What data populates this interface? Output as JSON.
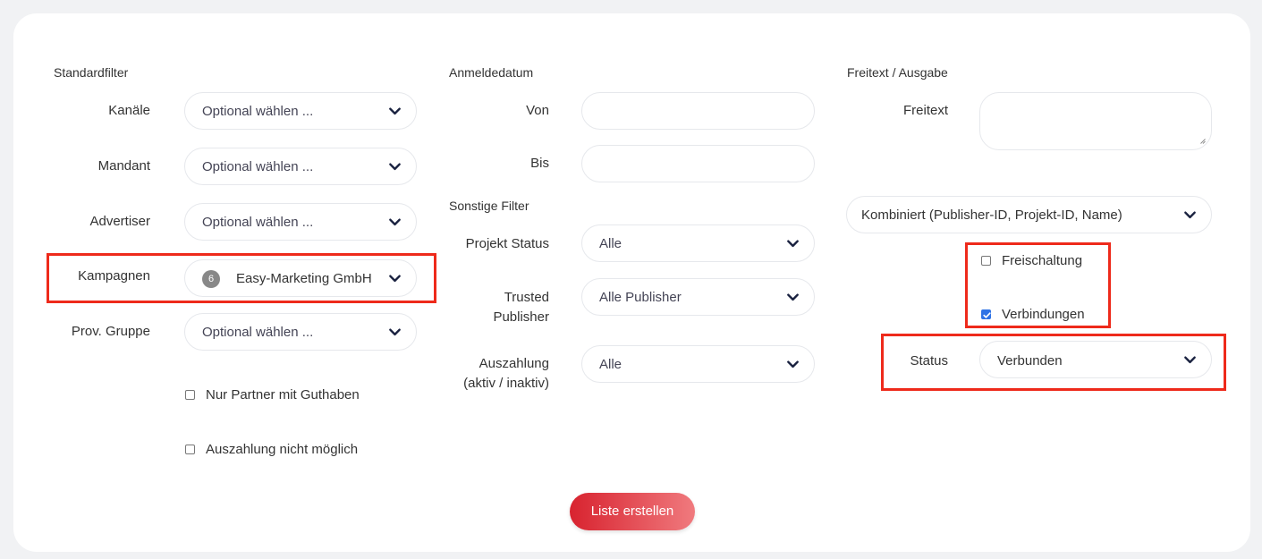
{
  "col1": {
    "section_title": "Standardfilter",
    "fields": [
      {
        "label": "Kanäle",
        "value": "Optional wählen ..."
      },
      {
        "label": "Mandant",
        "value": "Optional wählen ..."
      },
      {
        "label": "Advertiser",
        "value": "Optional wählen ..."
      },
      {
        "label": "Kampagnen",
        "value": "Easy-Marketing GmbH",
        "badge": "6"
      },
      {
        "label": "Prov. Gruppe",
        "value": "Optional wählen ..."
      }
    ],
    "checkboxes": [
      {
        "label": "Nur Partner mit Guthaben",
        "checked": false
      },
      {
        "label": "Auszahlung nicht möglich",
        "checked": false
      }
    ]
  },
  "col2": {
    "section_title": "Anmeldedatum",
    "von_label": "Von",
    "bis_label": "Bis",
    "other_title": "Sonstige Filter",
    "projekt_status": {
      "label": "Projekt Status",
      "value": "Alle"
    },
    "trusted": {
      "label_line1": "Trusted",
      "label_line2": "Publisher",
      "value": "Alle Publisher"
    },
    "auszahlung": {
      "label_line1": "Auszahlung",
      "label_line2": "(aktiv / inaktiv)",
      "value": "Alle"
    }
  },
  "col3": {
    "section_title": "Freitext / Ausgabe",
    "freitext_label": "Freitext",
    "freitext_value": "",
    "combined": {
      "value": "Kombiniert (Publisher-ID, Projekt-ID, Name)"
    },
    "checkboxes": [
      {
        "label": "Freischaltung",
        "checked": false
      },
      {
        "label": "Verbindungen",
        "checked": true
      }
    ],
    "status": {
      "label": "Status",
      "value": "Verbunden"
    }
  },
  "submit_label": "Liste erstellen",
  "colors": {
    "accent": "#d8232f",
    "highlight": "#ee2a1b",
    "checkbox": "#2f73e6"
  },
  "icons": {
    "dropdown": "chevron-down-icon",
    "checkmark": "checkmark-icon"
  }
}
